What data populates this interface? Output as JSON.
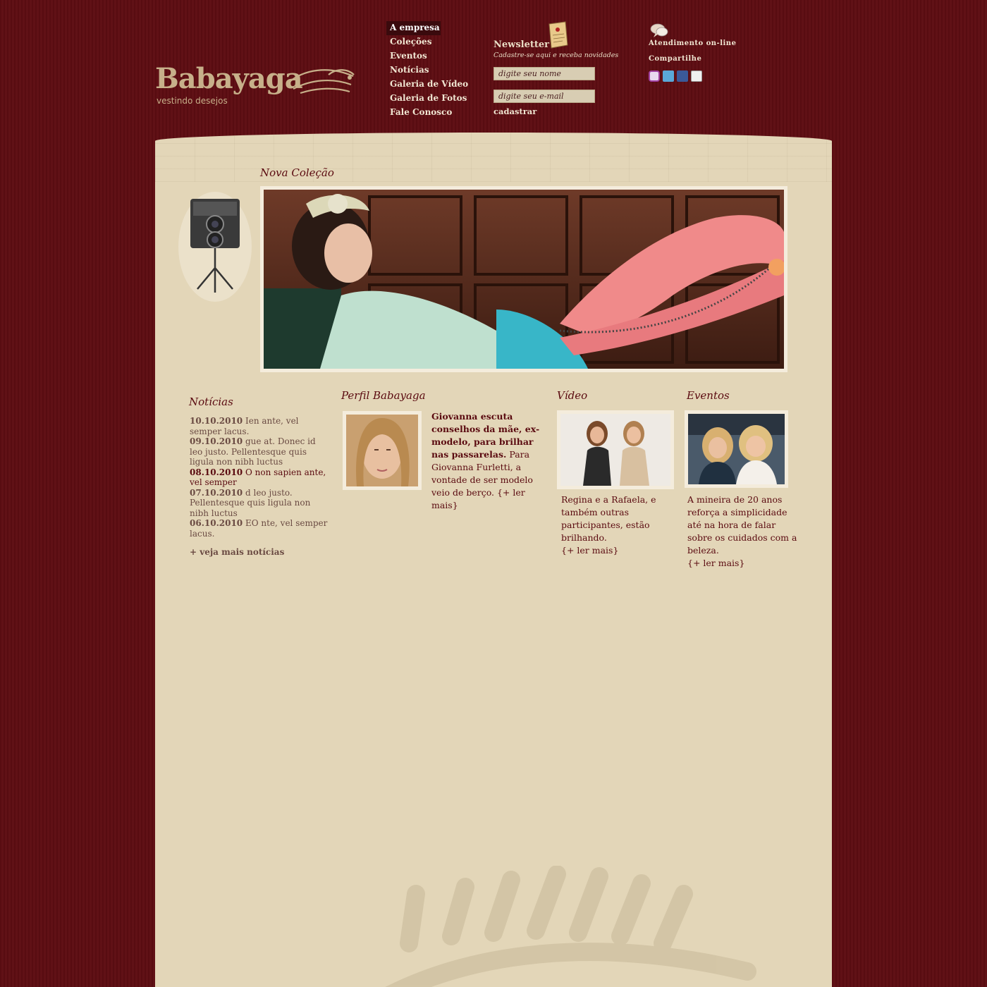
{
  "brand": {
    "name": "Babayaga",
    "tagline": "vestindo desejos"
  },
  "nav": {
    "items": [
      {
        "label": "A empresa",
        "active": true
      },
      {
        "label": "Coleções"
      },
      {
        "label": "Eventos"
      },
      {
        "label": "Notícias"
      },
      {
        "label": "Galeria de Vídeo"
      },
      {
        "label": "Galeria de Fotos"
      },
      {
        "label": "Fale Conosco"
      }
    ]
  },
  "newsletter": {
    "title": "Newsletter",
    "subtitle": "Cadastre-se aqui e receba novidades",
    "name_placeholder": "digite seu nome",
    "email_placeholder": "digite seu e-mail",
    "submit_label": "cadastrar"
  },
  "topright": {
    "atendimento": "Atendimento on-line",
    "compartilhe": "Compartilhe",
    "social_icons": [
      "orkut-icon",
      "twitter-icon",
      "facebook-icon",
      "email-icon"
    ]
  },
  "hero": {
    "title": "Nova Coleção"
  },
  "news": {
    "title": "Notícias",
    "items": [
      {
        "date": "10.10.2010",
        "text": "Ien ante, vel semper lacus."
      },
      {
        "date": "09.10.2010",
        "text": "gue at. Donec id leo justo. Pellentesque quis ligula non nibh luctus"
      },
      {
        "date": "08.10.2010",
        "text": "O non sapien ante, vel semper"
      },
      {
        "date": "07.10.2010",
        "text": "d leo justo. Pellentesque quis ligula non nibh luctus"
      },
      {
        "date": "06.10.2010",
        "text": "EO nte, vel semper lacus."
      }
    ],
    "more_label": "+ veja mais notícias"
  },
  "perfil": {
    "title": "Perfil Babayaga",
    "headline": "Giovanna escuta conselhos da mãe, ex-modelo, para brilhar nas passarelas.",
    "body": "Para Giovanna Furletti, a vontade de ser modelo veio de berço.",
    "more": "{+ ler mais}"
  },
  "video": {
    "title": "Vídeo",
    "text": "Regina e a Rafaela, e também outras participantes, estão brilhando.",
    "more": "{+ ler mais}"
  },
  "eventos": {
    "title": "Eventos",
    "text": "A mineira de 20 anos reforça a simplicidade até na hora de falar sobre os cuidados com a beleza.",
    "more": "{+ ler mais}"
  },
  "colors": {
    "background": "#5e0d12",
    "panel": "#e3d6b8",
    "accent": "#5a0a10",
    "nav_text": "#f0e6d2"
  }
}
